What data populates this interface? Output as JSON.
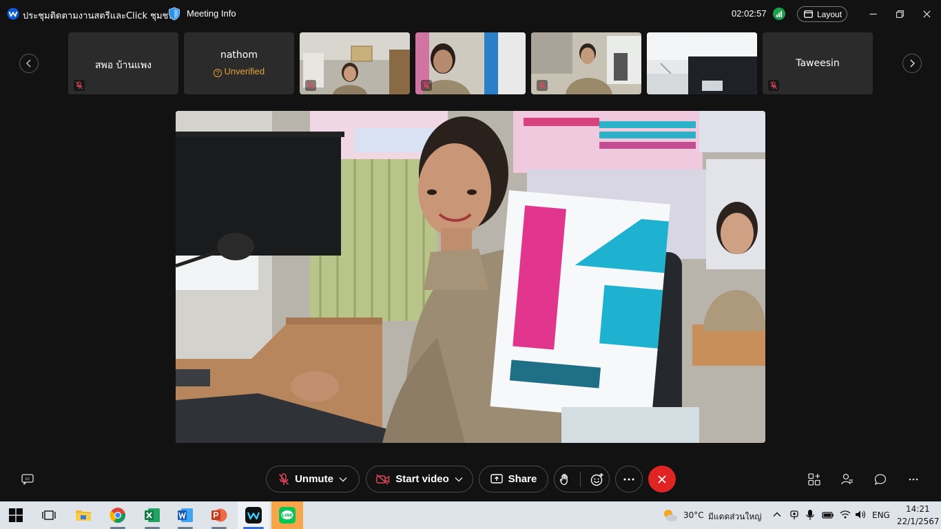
{
  "window": {
    "title": "ประชุมติดตามงานสตรีและClick ชุมชน",
    "meeting_info_label": "Meeting Info",
    "timer": "02:02:57",
    "layout_label": "Layout"
  },
  "participants": [
    {
      "name": "สพอ บ้านแพง",
      "sub": "",
      "muted": true,
      "has_video": false
    },
    {
      "name": "nathom",
      "sub": "Unverified",
      "muted": false,
      "has_video": false
    },
    {
      "name": "",
      "sub": "",
      "muted": true,
      "has_video": true
    },
    {
      "name": "",
      "sub": "",
      "muted": true,
      "has_video": true
    },
    {
      "name": "",
      "sub": "",
      "muted": true,
      "has_video": true
    },
    {
      "name": "",
      "sub": "",
      "muted": false,
      "has_video": true
    },
    {
      "name": "Taweesin",
      "sub": "",
      "muted": true,
      "has_video": false
    }
  ],
  "controls": {
    "unmute_label": "Unmute",
    "start_video_label": "Start video",
    "share_label": "Share"
  },
  "taskbar": {
    "temperature": "30°C",
    "weather": "มีแดดส่วนใหญ่",
    "language": "ENG",
    "time": "14:21",
    "date": "22/1/2567"
  },
  "colors": {
    "background": "#121212",
    "tile": "#2b2b2b",
    "end_call": "#e02424",
    "unverified": "#e9a23b",
    "mic_off": "#e0475d",
    "taskbar": "#dfe3ea"
  },
  "icons": {
    "app": "webex-logo-icon",
    "security": "shield-icon",
    "mute": "mic-off-icon",
    "video": "video-off-icon",
    "share": "share-screen-icon",
    "raise_hand": "hand-icon",
    "reactions": "emoji-icon",
    "more": "more-icon",
    "end": "close-icon"
  }
}
